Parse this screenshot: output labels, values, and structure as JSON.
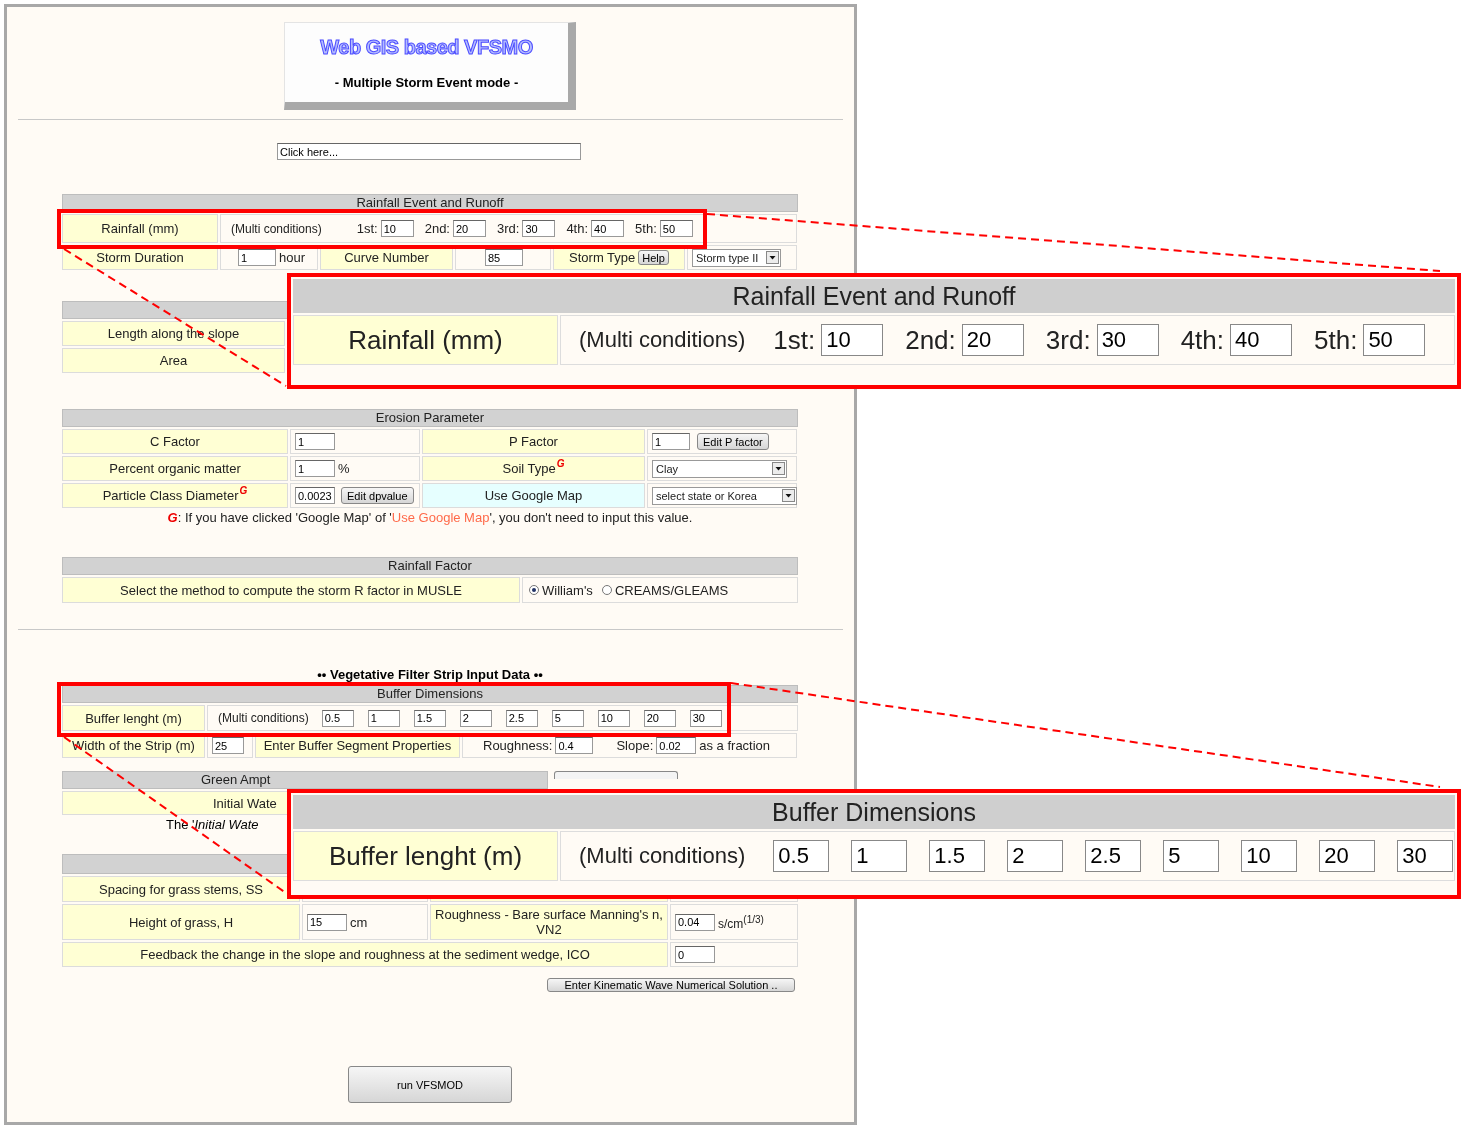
{
  "header": {
    "title": "Web GIS based VFSMO",
    "subtitle": "- Multiple Storm Event mode -"
  },
  "location_field": {
    "value": "Click here..."
  },
  "rainfall_event": {
    "title": "Rainfall Event and Runoff",
    "rainfall": {
      "label": "Rainfall (mm)",
      "note": "(Multi conditions)",
      "events": [
        {
          "label": "1st:",
          "value": "10"
        },
        {
          "label": "2nd:",
          "value": "20"
        },
        {
          "label": "3rd:",
          "value": "30"
        },
        {
          "label": "4th:",
          "value": "40"
        },
        {
          "label": "5th:",
          "value": "50"
        }
      ]
    },
    "storm_duration": {
      "label": "Storm Duration",
      "value": "1",
      "unit": "hour"
    },
    "curve_number": {
      "label": "Curve Number",
      "value": "85"
    },
    "storm_type": {
      "label": "Storm Type",
      "help_button": "Help",
      "value": "Storm type II"
    }
  },
  "watershed": {
    "rows": [
      "Length along the slope",
      "Area"
    ]
  },
  "erosion": {
    "title": "Erosion Parameter",
    "c_factor": {
      "label": "C Factor",
      "value": "1"
    },
    "p_factor": {
      "label": "P Factor",
      "value": "1",
      "button": "Edit P factor"
    },
    "organic_matter": {
      "label": "Percent organic matter",
      "value": "1",
      "unit": "%"
    },
    "soil_type": {
      "label": "Soil Type",
      "mark": "G",
      "value": "Clay"
    },
    "particle_diameter": {
      "label": "Particle Class Diameter",
      "mark": "G",
      "value": "0.0023",
      "button": "Edit dpvalue"
    },
    "google_map": {
      "label": "Use Google Map",
      "value": "select state or Korea"
    },
    "note": {
      "mark": "G",
      "before": ": If you have clicked 'Google Map' of '",
      "highlight": "Use Google Map",
      "after": "', you don't need to input this value."
    }
  },
  "r_factor": {
    "title": "Rainfall Factor",
    "label": "Select the method to compute the storm R factor in MUSLE",
    "options": [
      {
        "label": "William's",
        "selected": true
      },
      {
        "label": "CREAMS/GLEAMS",
        "selected": false
      }
    ]
  },
  "vfs_title": "•• Vegetative Filter Strip Input Data ••",
  "buffer": {
    "title": "Buffer Dimensions",
    "length": {
      "label": "Buffer lenght (m)",
      "note": "(Multi conditions)",
      "values": [
        "0.5",
        "1",
        "1.5",
        "2",
        "2.5",
        "5",
        "10",
        "20",
        "30"
      ]
    },
    "width": {
      "label": "Width of the Strip (m)",
      "value": "25"
    },
    "segment": {
      "label": "Enter Buffer Segment Properties",
      "roughness_label": "Roughness:",
      "roughness": "0.4",
      "slope_label": "Slope:",
      "slope": "0.02",
      "unit": "as a fraction"
    }
  },
  "green_ampt": {
    "title": "Green Ampt",
    "row_label": "Initial Wate",
    "note": "The '*Initial Wate*"
  },
  "grass": {
    "spacing": {
      "label": "Spacing for grass stems, SS"
    },
    "height": {
      "label": "Height of grass, H",
      "value": "15",
      "unit": "cm"
    },
    "manning": {
      "label": "Roughness - Bare surface Manning's n, VN2",
      "value": "0.04",
      "unit": "s/cm$^{(1/3)}$"
    },
    "feedback": {
      "label": "Feedback the change in the slope and roughness at the sediment wedge, ICO",
      "value": "0"
    },
    "kinematic_button": "Enter Kinematic Wave Numerical Solution .."
  },
  "run_button": "run VFSMOD",
  "callouts": [
    {
      "title": "Rainfall Event and Runoff",
      "label": "Rainfall (mm)",
      "note": "(Multi conditions)",
      "fields": [
        {
          "label": "1st:",
          "value": "10"
        },
        {
          "label": "2nd:",
          "value": "20"
        },
        {
          "label": "3rd:",
          "value": "30"
        },
        {
          "label": "4th:",
          "value": "40"
        },
        {
          "label": "5th:",
          "value": "50"
        }
      ]
    },
    {
      "title": "Buffer Dimensions",
      "label": "Buffer lenght (m)",
      "note": "(Multi conditions)",
      "fields": [
        {
          "value": "0.5"
        },
        {
          "value": "1"
        },
        {
          "value": "1.5"
        },
        {
          "value": "2"
        },
        {
          "value": "2.5"
        },
        {
          "value": "5"
        },
        {
          "value": "10"
        },
        {
          "value": "20"
        },
        {
          "value": "30"
        }
      ]
    }
  ]
}
